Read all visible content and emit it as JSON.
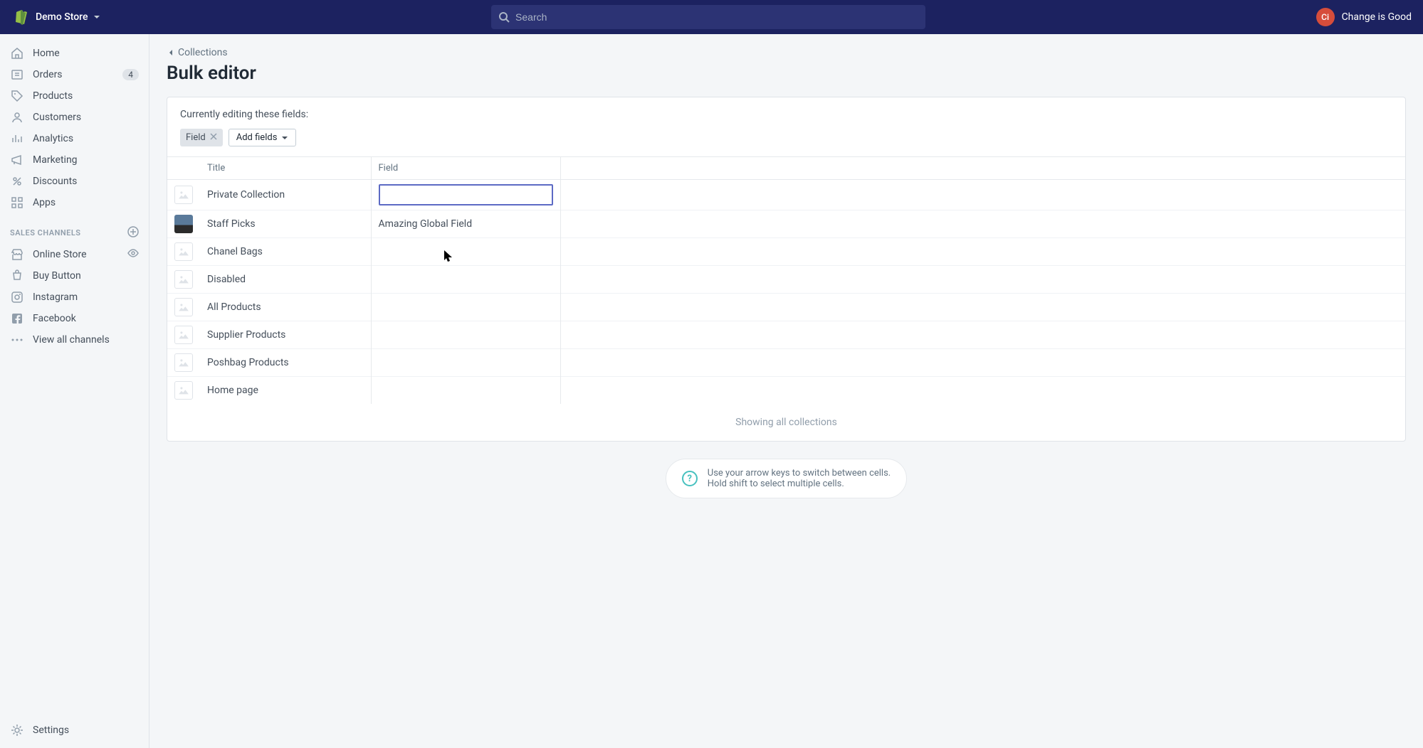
{
  "topbar": {
    "store_name": "Demo Store",
    "search_placeholder": "Search",
    "user_initials": "Ci",
    "user_name": "Change is Good"
  },
  "sidebar": {
    "items": [
      {
        "label": "Home",
        "icon": "home"
      },
      {
        "label": "Orders",
        "icon": "orders",
        "badge": "4"
      },
      {
        "label": "Products",
        "icon": "products"
      },
      {
        "label": "Customers",
        "icon": "customers"
      },
      {
        "label": "Analytics",
        "icon": "analytics"
      },
      {
        "label": "Marketing",
        "icon": "marketing"
      },
      {
        "label": "Discounts",
        "icon": "discounts"
      },
      {
        "label": "Apps",
        "icon": "apps"
      }
    ],
    "channels_header": "SALES CHANNELS",
    "channels": [
      {
        "label": "Online Store",
        "trailing": "eye"
      },
      {
        "label": "Buy Button"
      },
      {
        "label": "Instagram"
      },
      {
        "label": "Facebook"
      }
    ],
    "view_all": "View all channels",
    "settings": "Settings"
  },
  "page": {
    "breadcrumb": "Collections",
    "title": "Bulk editor",
    "editing_label": "Currently editing these fields:",
    "field_chip": "Field",
    "add_fields": "Add fields",
    "columns": {
      "title": "Title",
      "field": "Field"
    },
    "rows": [
      {
        "title": "Private Collection",
        "field": "",
        "thumb": "placeholder",
        "editing": true
      },
      {
        "title": "Staff Picks",
        "field": "Amazing Global Field",
        "thumb": "photo"
      },
      {
        "title": "Chanel Bags",
        "field": "",
        "thumb": "placeholder"
      },
      {
        "title": "Disabled",
        "field": "",
        "thumb": "placeholder"
      },
      {
        "title": "All Products",
        "field": "",
        "thumb": "placeholder"
      },
      {
        "title": "Supplier Products",
        "field": "",
        "thumb": "placeholder"
      },
      {
        "title": "Poshbag Products",
        "field": "",
        "thumb": "placeholder"
      },
      {
        "title": "Home page",
        "field": "",
        "thumb": "placeholder"
      }
    ],
    "footer": "Showing all collections",
    "tip_line1": "Use your arrow keys to switch between cells.",
    "tip_line2": "Hold shift to select multiple cells."
  }
}
